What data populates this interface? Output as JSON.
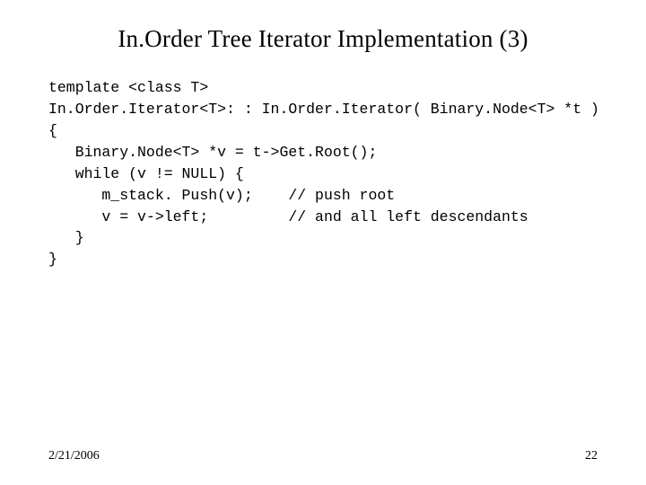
{
  "title": "In.Order Tree Iterator Implementation (3)",
  "code": {
    "l1": "template <class T>",
    "l2": "In.Order.Iterator<T>: : In.Order.Iterator( Binary.Node<T> *t )",
    "l3": "{",
    "l4": "   Binary.Node<T> *v = t->Get.Root();",
    "l5": "   while (v != NULL) {",
    "l6": "      m_stack. Push(v);    // push root",
    "l7": "      v = v->left;         // and all left descendants",
    "l8": "   }",
    "l9": "}"
  },
  "footer": {
    "date": "2/21/2006",
    "page": "22"
  }
}
